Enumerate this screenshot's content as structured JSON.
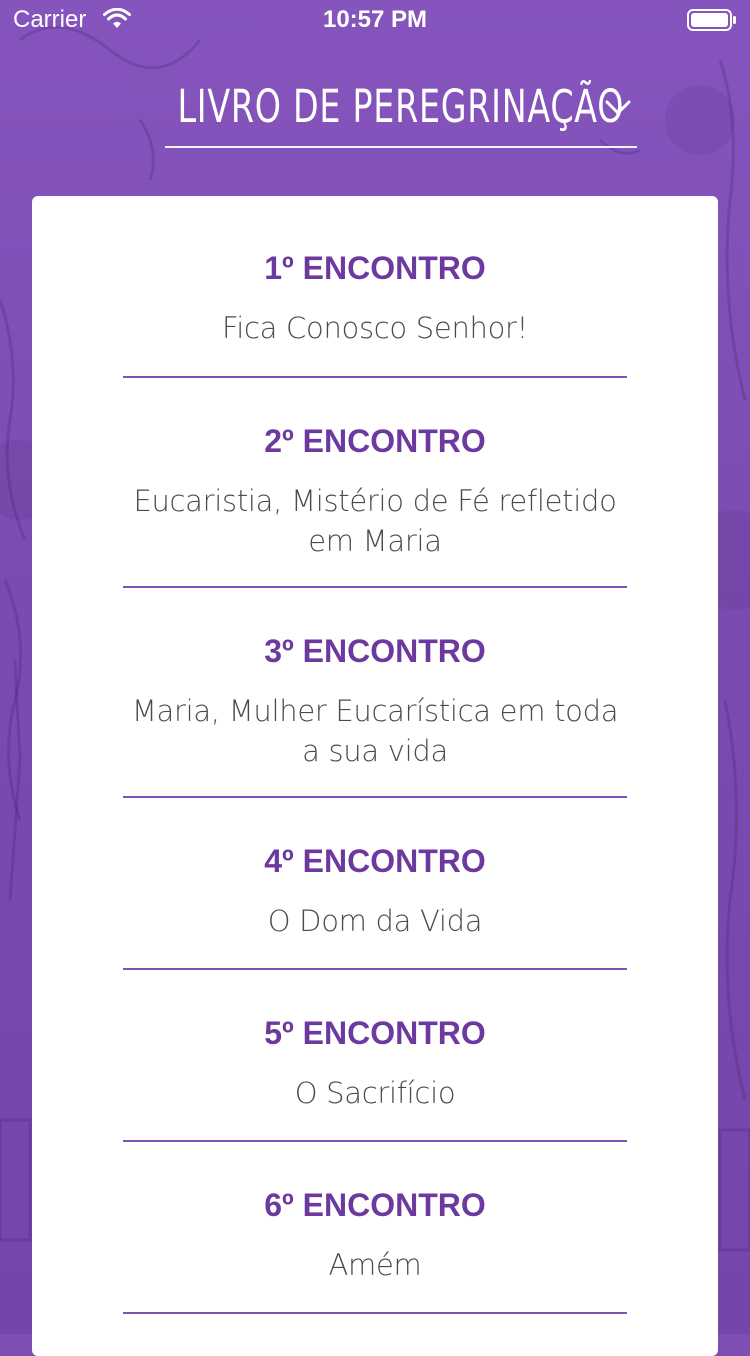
{
  "status_bar": {
    "carrier": "Carrier",
    "time": "10:57 PM"
  },
  "header": {
    "title": "LIVRO DE PEREGRINAÇÃO",
    "dropdown_icon": "chevron-down-icon"
  },
  "encounters": [
    {
      "title": "1º ENCONTRO",
      "subtitle": "Fica Conosco Senhor!"
    },
    {
      "title": "2º ENCONTRO",
      "subtitle": "Eucaristia, Mistério de Fé  refletido em Maria"
    },
    {
      "title": "3º ENCONTRO",
      "subtitle": "Maria, Mulher Eucarística  em toda a sua vida"
    },
    {
      "title": "4º ENCONTRO",
      "subtitle": "O Dom da Vida"
    },
    {
      "title": "5º ENCONTRO",
      "subtitle": "O Sacrifício"
    },
    {
      "title": "6º ENCONTRO",
      "subtitle": "Amém"
    }
  ],
  "colors": {
    "background": "#7d4fb3",
    "accent": "#6c3a9e",
    "divider": "#7c52b4",
    "text": "#4b4b4b",
    "card": "#ffffff"
  }
}
